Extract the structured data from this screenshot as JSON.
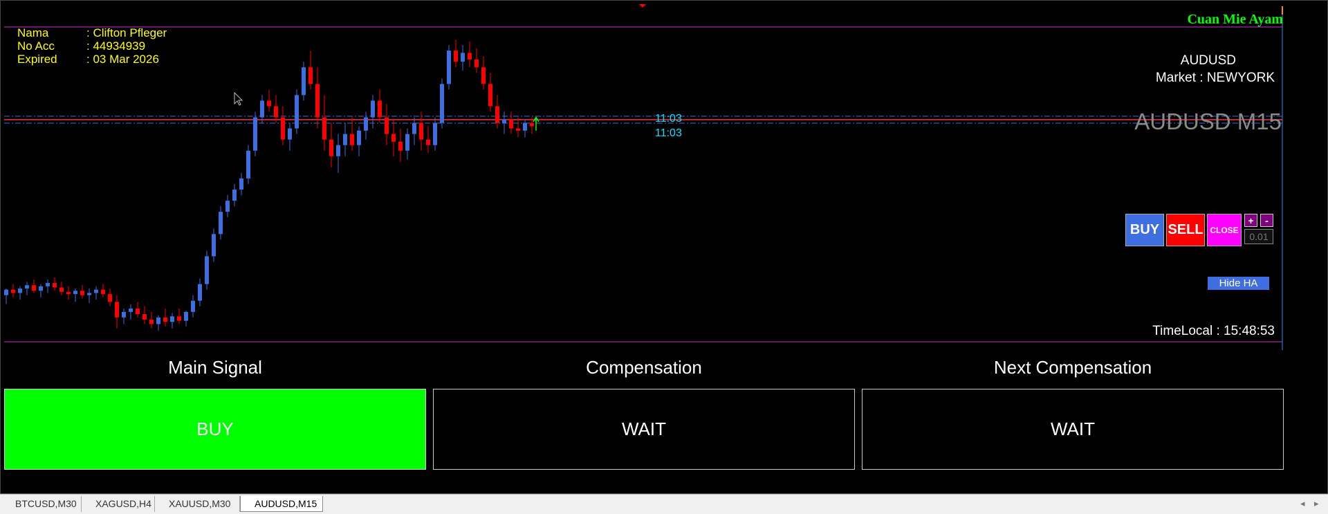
{
  "account": {
    "name_label": "Nama",
    "name_value": ": Clifton Pfleger",
    "acc_label": "No Acc",
    "acc_value": ": 44934939",
    "expired_label": "Expired",
    "expired_value": ": 03 Mar 2026"
  },
  "brand": "Cuan Mie Ayam",
  "symbol": "AUDUSD",
  "market": "Market : NEWYORK",
  "chart_symbol": "AUDUSD M15",
  "line_time_labels": [
    "11:03",
    "11:03"
  ],
  "trade_panel": {
    "buy": "BUY",
    "sell": "SELL",
    "close": "CLOSE",
    "plus": "+",
    "minus": "-",
    "lot": "0.01"
  },
  "hide_ha": "Hide HA",
  "time_local": "TimeLocal : 15:48:53",
  "signals": [
    {
      "title": "Main Signal",
      "value": "BUY"
    },
    {
      "title": "Compensation",
      "value": "WAIT"
    },
    {
      "title": "Next Compensation",
      "value": "WAIT"
    }
  ],
  "tabs": [
    "BTCUSD,M30",
    "XAGUSD,H4",
    "XAUUSD,M30",
    "AUDUSD,M15"
  ],
  "active_tab": 3,
  "colors": {
    "bull": "#3f6ee0",
    "bear": "#ff0000",
    "accent": "#cc33cc",
    "buy_signal": "#00ff00"
  },
  "candles": [
    [
      0.661,
      0.6616,
      0.6602,
      0.6615
    ],
    [
      0.6615,
      0.662,
      0.6608,
      0.6612
    ],
    [
      0.6612,
      0.6618,
      0.6606,
      0.6616
    ],
    [
      0.6616,
      0.6622,
      0.661,
      0.6619
    ],
    [
      0.6619,
      0.6624,
      0.6612,
      0.6614
    ],
    [
      0.6614,
      0.662,
      0.6608,
      0.6618
    ],
    [
      0.6618,
      0.6624,
      0.6612,
      0.6621
    ],
    [
      0.6621,
      0.6626,
      0.6614,
      0.6617
    ],
    [
      0.6617,
      0.6622,
      0.661,
      0.6613
    ],
    [
      0.6613,
      0.6618,
      0.6606,
      0.6611
    ],
    [
      0.6611,
      0.6616,
      0.6604,
      0.6614
    ],
    [
      0.6614,
      0.6619,
      0.6607,
      0.661
    ],
    [
      0.661,
      0.6616,
      0.6603,
      0.6612
    ],
    [
      0.6612,
      0.6618,
      0.6606,
      0.6615
    ],
    [
      0.6615,
      0.662,
      0.6608,
      0.6611
    ],
    [
      0.6611,
      0.6616,
      0.66,
      0.6604
    ],
    [
      0.6604,
      0.661,
      0.658,
      0.659
    ],
    [
      0.659,
      0.6598,
      0.6584,
      0.6595
    ],
    [
      0.6595,
      0.6602,
      0.6588,
      0.6598
    ],
    [
      0.6598,
      0.6604,
      0.659,
      0.6593
    ],
    [
      0.6593,
      0.66,
      0.6584,
      0.6588
    ],
    [
      0.6588,
      0.6595,
      0.658,
      0.6584
    ],
    [
      0.6584,
      0.6592,
      0.6578,
      0.659
    ],
    [
      0.659,
      0.6598,
      0.6582,
      0.6586
    ],
    [
      0.6586,
      0.6594,
      0.658,
      0.6591
    ],
    [
      0.6591,
      0.6598,
      0.6584,
      0.6587
    ],
    [
      0.6587,
      0.6596,
      0.6582,
      0.6595
    ],
    [
      0.6595,
      0.661,
      0.659,
      0.6605
    ],
    [
      0.6605,
      0.6625,
      0.66,
      0.662
    ],
    [
      0.662,
      0.665,
      0.6615,
      0.6645
    ],
    [
      0.6645,
      0.667,
      0.664,
      0.6665
    ],
    [
      0.6665,
      0.669,
      0.666,
      0.6685
    ],
    [
      0.6685,
      0.67,
      0.668,
      0.6695
    ],
    [
      0.6695,
      0.671,
      0.669,
      0.6705
    ],
    [
      0.6705,
      0.672,
      0.67,
      0.6715
    ],
    [
      0.6715,
      0.6745,
      0.671,
      0.674
    ],
    [
      0.674,
      0.6775,
      0.6735,
      0.677
    ],
    [
      0.677,
      0.679,
      0.6765,
      0.6785
    ],
    [
      0.6785,
      0.6795,
      0.6775,
      0.678
    ],
    [
      0.678,
      0.679,
      0.6765,
      0.677
    ],
    [
      0.677,
      0.678,
      0.6745,
      0.675
    ],
    [
      0.675,
      0.6765,
      0.674,
      0.676
    ],
    [
      0.676,
      0.6795,
      0.6755,
      0.679
    ],
    [
      0.679,
      0.682,
      0.6785,
      0.6815
    ],
    [
      0.6815,
      0.683,
      0.6795,
      0.68
    ],
    [
      0.68,
      0.6815,
      0.676,
      0.677
    ],
    [
      0.677,
      0.679,
      0.674,
      0.675
    ],
    [
      0.675,
      0.6765,
      0.6725,
      0.6735
    ],
    [
      0.6735,
      0.6755,
      0.672,
      0.6745
    ],
    [
      0.6745,
      0.6765,
      0.6735,
      0.6755
    ],
    [
      0.6755,
      0.677,
      0.674,
      0.6745
    ],
    [
      0.6745,
      0.6762,
      0.6735,
      0.6758
    ],
    [
      0.6758,
      0.6775,
      0.675,
      0.677
    ],
    [
      0.677,
      0.679,
      0.676,
      0.6785
    ],
    [
      0.6785,
      0.6795,
      0.6765,
      0.677
    ],
    [
      0.677,
      0.6782,
      0.6745,
      0.6755
    ],
    [
      0.6755,
      0.6768,
      0.6735,
      0.6748
    ],
    [
      0.6748,
      0.676,
      0.673,
      0.674
    ],
    [
      0.674,
      0.676,
      0.6732,
      0.6755
    ],
    [
      0.6755,
      0.677,
      0.6745,
      0.6765
    ],
    [
      0.6765,
      0.6775,
      0.674,
      0.675
    ],
    [
      0.675,
      0.6762,
      0.6738,
      0.6745
    ],
    [
      0.6745,
      0.677,
      0.674,
      0.6765
    ],
    [
      0.6765,
      0.6805,
      0.676,
      0.68
    ],
    [
      0.68,
      0.6835,
      0.6795,
      0.683
    ],
    [
      0.683,
      0.684,
      0.6815,
      0.682
    ],
    [
      0.682,
      0.6835,
      0.6812,
      0.6828
    ],
    [
      0.6828,
      0.6838,
      0.6815,
      0.6822
    ],
    [
      0.6822,
      0.6832,
      0.681,
      0.6815
    ],
    [
      0.6815,
      0.6825,
      0.6795,
      0.68
    ],
    [
      0.68,
      0.681,
      0.6775,
      0.678
    ],
    [
      0.678,
      0.679,
      0.676,
      0.6765
    ],
    [
      0.6765,
      0.6775,
      0.6755,
      0.6768
    ],
    [
      0.6768,
      0.6775,
      0.6755,
      0.676
    ],
    [
      0.676,
      0.677,
      0.6752,
      0.6758
    ],
    [
      0.6758,
      0.6768,
      0.6752,
      0.6765
    ],
    [
      0.6765,
      0.677,
      0.6755,
      0.6762
    ]
  ]
}
